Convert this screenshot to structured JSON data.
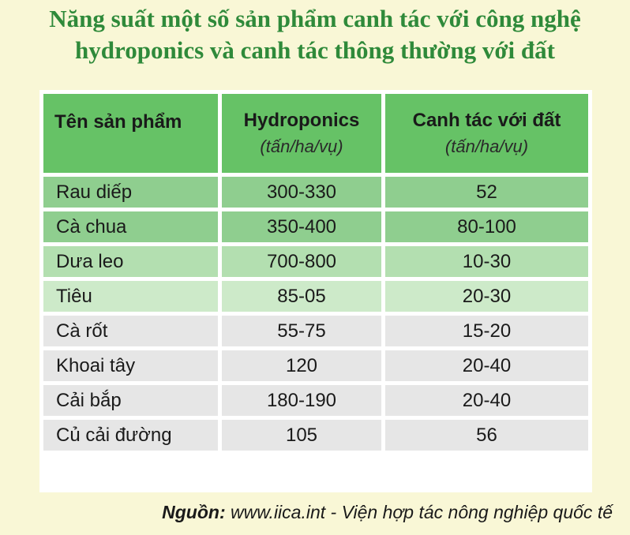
{
  "title": {
    "line1": "Năng suất một số sản phẩm canh tác với công nghệ",
    "line2": "hydroponics và canh tác thông thường với đất"
  },
  "table": {
    "headers": [
      {
        "label": "Tên sản phẩm",
        "unit": ""
      },
      {
        "label": "Hydroponics",
        "unit": "(tấn/ha/vụ)"
      },
      {
        "label": "Canh tác với đất",
        "unit": "(tấn/ha/vụ)"
      }
    ],
    "rows": [
      {
        "name": "Rau diếp",
        "hydroponics": "300-330",
        "soil": "52"
      },
      {
        "name": "Cà chua",
        "hydroponics": "350-400",
        "soil": "80-100"
      },
      {
        "name": "Dưa leo",
        "hydroponics": "700-800",
        "soil": "10-30"
      },
      {
        "name": "Tiêu",
        "hydroponics": "85-05",
        "soil": "20-30"
      },
      {
        "name": "Cà rốt",
        "hydroponics": "55-75",
        "soil": "15-20"
      },
      {
        "name": "Khoai tây",
        "hydroponics": "120",
        "soil": "20-40"
      },
      {
        "name": "Cải bắp",
        "hydroponics": "180-190",
        "soil": "20-40"
      },
      {
        "name": "Củ cải đường",
        "hydroponics": "105",
        "soil": "56"
      }
    ]
  },
  "source": {
    "label": "Nguồn:",
    "text": " www.iica.int - Viện hợp tác nông nghiệp quốc tế"
  },
  "colors": {
    "title": "#2f8a3a",
    "header": "#66c266",
    "background": "#f9f7d6"
  }
}
